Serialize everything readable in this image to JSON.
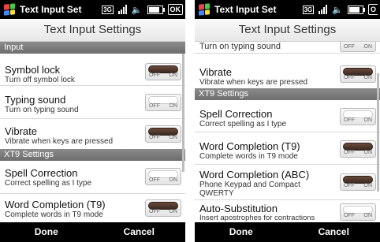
{
  "left": {
    "app_title": "Text Input Set",
    "status": {
      "network": "3G",
      "ok": "OK"
    },
    "heading": "Text Input Settings",
    "sections": {
      "input": "Input",
      "xt9": "XT9 Settings"
    },
    "rows": {
      "symbol_lock": {
        "title": "Symbol lock",
        "subtitle": "Turn off symbol lock",
        "on": true
      },
      "typing_sound": {
        "title": "Typing sound",
        "subtitle": "Turn on typing sound",
        "on": false
      },
      "vibrate": {
        "title": "Vibrate",
        "subtitle": "Vibrate when keys are pressed",
        "on": true
      },
      "spell_correction": {
        "title": "Spell Correction",
        "subtitle": "Correct spelling as I type",
        "on": false
      },
      "word_completion_t9": {
        "title": "Word Completion (T9)",
        "subtitle": "Complete words in T9 mode",
        "on": true
      }
    },
    "toggle_labels": {
      "off": "OFF",
      "on": "ON"
    },
    "softkeys": {
      "left": "Done",
      "right": "Cancel"
    }
  },
  "right": {
    "app_title": "Text Input Set",
    "status": {
      "network": "3G",
      "ok": "O"
    },
    "heading": "Text Input Settings",
    "sections": {
      "xt9": "XT9 Settings"
    },
    "rows": {
      "typing_sound_partial": {
        "subtitle": "Turn on typing sound",
        "on": false
      },
      "vibrate": {
        "title": "Vibrate",
        "subtitle": "Vibrate when keys are pressed",
        "on": true
      },
      "spell_correction": {
        "title": "Spell Correction",
        "subtitle": "Correct spelling as I type",
        "on": false
      },
      "word_completion_t9": {
        "title": "Word Completion (T9)",
        "subtitle": "Complete words in T9 mode",
        "on": true
      },
      "word_completion_abc": {
        "title": "Word Completion (ABC)",
        "subtitle_line1": "Phone Keypad and Compact",
        "subtitle_line2": "QWERTY",
        "on": true
      },
      "auto_substitution": {
        "title": "Auto-Substitution",
        "subtitle": "Insert apostrophes for contractions",
        "on": false
      }
    },
    "toggle_labels": {
      "off": "OFF",
      "on": "ON"
    },
    "softkeys": {
      "left": "Done",
      "right": "Cancel"
    }
  },
  "colors": {
    "toggle_on_knob": "#4a342a",
    "section_bg": "#7a7a7a",
    "bar_bg": "#000000"
  }
}
